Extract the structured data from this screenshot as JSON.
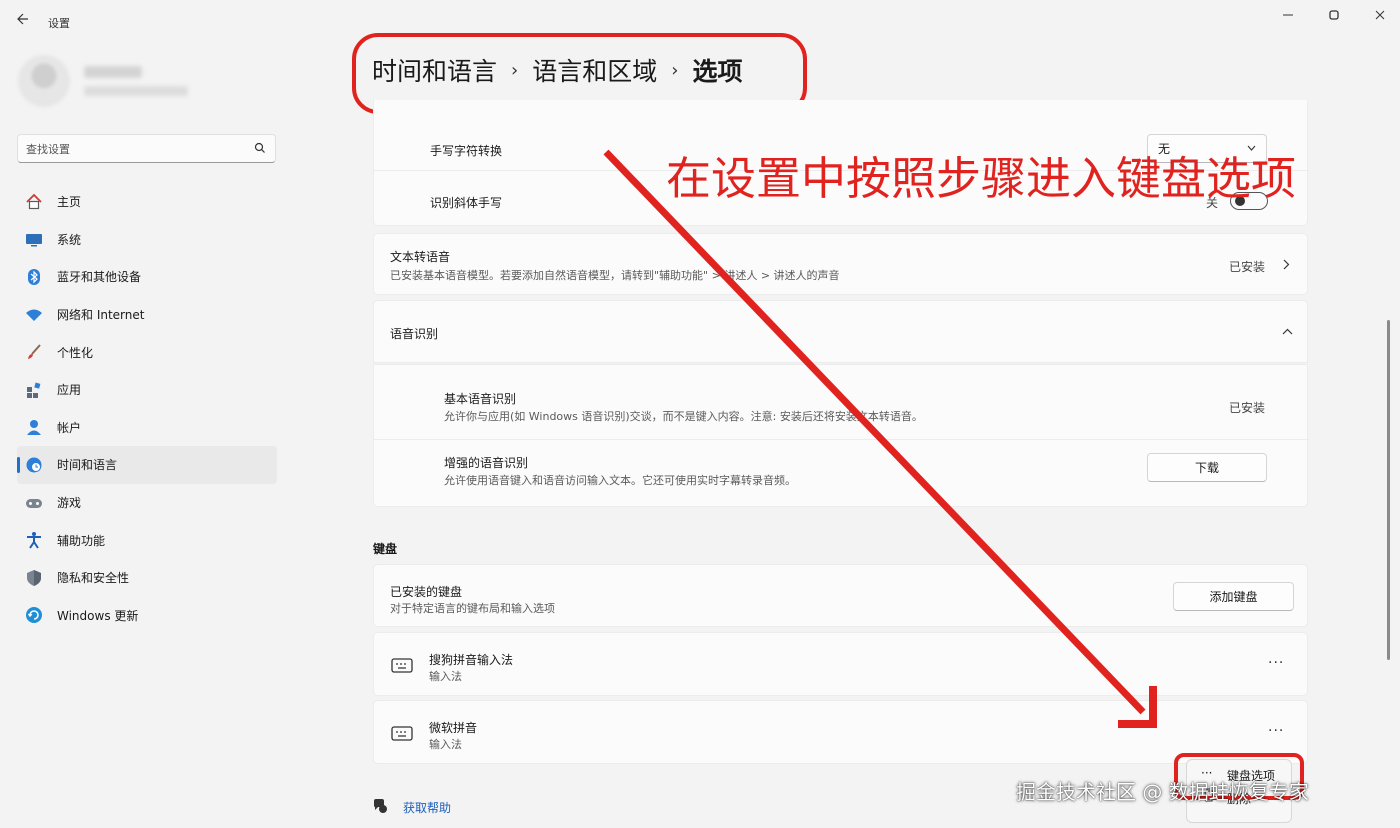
{
  "window": {
    "title": "设置",
    "back_icon": "arrow-left-icon",
    "minimize_icon": "minimize-icon",
    "maximize_icon": "restore-icon"
  },
  "sidebar": {
    "search_placeholder": "查找设置",
    "items": [
      {
        "label": "主页",
        "icon": "home-icon",
        "active": false
      },
      {
        "label": "系统",
        "icon": "system-icon",
        "active": false
      },
      {
        "label": "蓝牙和其他设备",
        "icon": "bluetooth-icon",
        "active": false
      },
      {
        "label": "网络和 Internet",
        "icon": "wifi-icon",
        "active": false
      },
      {
        "label": "个性化",
        "icon": "brush-icon",
        "active": false
      },
      {
        "label": "应用",
        "icon": "apps-icon",
        "active": false
      },
      {
        "label": "帐户",
        "icon": "account-icon",
        "active": false
      },
      {
        "label": "时间和语言",
        "icon": "globe-clock-icon",
        "active": true
      },
      {
        "label": "游戏",
        "icon": "gamepad-icon",
        "active": false
      },
      {
        "label": "辅助功能",
        "icon": "accessibility-icon",
        "active": false
      },
      {
        "label": "隐私和安全性",
        "icon": "shield-icon",
        "active": false
      },
      {
        "label": "Windows 更新",
        "icon": "update-icon",
        "active": false
      }
    ]
  },
  "breadcrumb": {
    "items": [
      "时间和语言",
      "语言和区域",
      "选项"
    ],
    "separator": "›"
  },
  "handwriting": {
    "char_convert_label": "手写字符转换",
    "char_convert_value": "无",
    "italic_label": "识别斜体手写",
    "italic_state": "关"
  },
  "tts": {
    "title": "文本转语音",
    "subtitle": "已安装基本语音模型。若要添加自然语音模型，请转到\"辅助功能\" > 讲述人 > 讲述人的声音",
    "status": "已安装"
  },
  "speech": {
    "title": "语音识别",
    "basic_title": "基本语音识别",
    "basic_subtitle": "允许你与应用(如 Windows 语音识别)交谈，而不是键入内容。注意: 安装后还将安装文本转语音。",
    "basic_status": "已安装",
    "enhanced_title": "增强的语音识别",
    "enhanced_subtitle": "允许使用语音键入和语音访问输入文本。它还可使用实时字幕转录音频。",
    "download_label": "下载"
  },
  "keyboard": {
    "section_title": "键盘",
    "installed_title": "已安装的键盘",
    "installed_subtitle": "对于特定语言的键布局和输入选项",
    "add_label": "添加键盘",
    "items": [
      {
        "title": "搜狗拼音输入法",
        "subtitle": "输入法"
      },
      {
        "title": "微软拼音",
        "subtitle": "输入法"
      }
    ],
    "more_label": "···"
  },
  "flyout": {
    "options_label": "键盘选项",
    "remove_label": "删除",
    "options_icon": "more-icon"
  },
  "help": {
    "label": "获取帮助",
    "icon": "help-chat-icon"
  },
  "annotation": {
    "text": "在设置中按照步骤进入键盘选项",
    "color": "#e0231f"
  },
  "watermark": {
    "text": "掘金技术社区 @ 数据蛙恢复专家"
  },
  "colors": {
    "accent": "#1f6fcc",
    "annotation_red": "#e0231f",
    "link": "#1f5fb8"
  }
}
